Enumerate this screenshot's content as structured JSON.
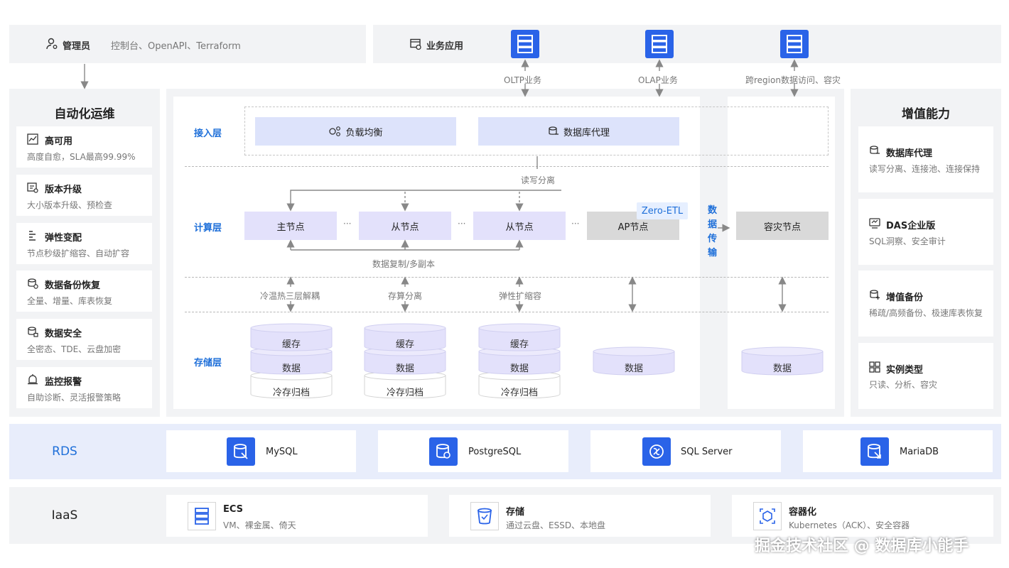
{
  "top": {
    "admin": {
      "label": "管理员",
      "desc": "控制台、OpenAPI、Terraform"
    },
    "biz": {
      "label": "业务应用"
    },
    "app_links": [
      "OLTP业务",
      "OLAP业务",
      "跨region数据访问、容灾"
    ]
  },
  "left": {
    "title": "自动化运维",
    "items": [
      {
        "title": "高可用",
        "desc": "高度自愈，SLA最高99.99%"
      },
      {
        "title": "版本升级",
        "desc": "大小版本升级、预检查"
      },
      {
        "title": "弹性变配",
        "desc": "节点秒级扩缩容、自动扩容"
      },
      {
        "title": "数据备份恢复",
        "desc": "全量、增量、库表恢复"
      },
      {
        "title": "数据安全",
        "desc": "全密态、TDE、云盘加密"
      },
      {
        "title": "监控报警",
        "desc": "自助诊断、灵活报警策略"
      }
    ]
  },
  "right": {
    "title": "增值能力",
    "items": [
      {
        "title": "数据库代理",
        "desc": "读写分离、连接池、连接保持"
      },
      {
        "title": "DAS企业版",
        "desc": "SQL洞察、安全审计"
      },
      {
        "title": "增值备份",
        "desc": "稀疏/高频备份、极速库表恢复"
      },
      {
        "title": "实例类型",
        "desc": "只读、分析、容灾"
      }
    ]
  },
  "center": {
    "layers": {
      "access": "接入层",
      "compute": "计算层",
      "storage": "存储层"
    },
    "access_nodes": [
      "负载均衡",
      "数据库代理"
    ],
    "rw_split": "读写分离",
    "compute_nodes": [
      "主节点",
      "从节点",
      "从节点",
      "AP节点"
    ],
    "ellipsis": "···",
    "zero_etl": "Zero-ETL",
    "transfer": [
      "数",
      "据",
      "传",
      "输"
    ],
    "dr_node": "容灾节点",
    "replication": "数据复制/多副本",
    "mid_labels": [
      "冷温热三层解耦",
      "存算分离",
      "弹性扩缩容"
    ],
    "stack": {
      "cache": "缓存",
      "data": "数据",
      "cold": "冷存归档"
    }
  },
  "rds": {
    "label": "RDS",
    "engines": [
      "MySQL",
      "PostgreSQL",
      "SQL Server",
      "MariaDB"
    ]
  },
  "iaas": {
    "label": "IaaS",
    "items": [
      {
        "title": "ECS",
        "desc": "VM、裸金属、倚天"
      },
      {
        "title": "存储",
        "desc": "通过云盘、ESSD、本地盘"
      },
      {
        "title": "容器化",
        "desc": "Kubernetes（ACK）、安全容器"
      }
    ]
  },
  "watermark": "掘金技术社区 @ 数据库小能手",
  "colors": {
    "accent": "#2a63e8",
    "purple": "#e3e1fb",
    "lavender": "#dde3fb",
    "gray_node": "#d9d9d9",
    "panel": "#f2f3f5",
    "rds_band": "#e8edfb"
  }
}
